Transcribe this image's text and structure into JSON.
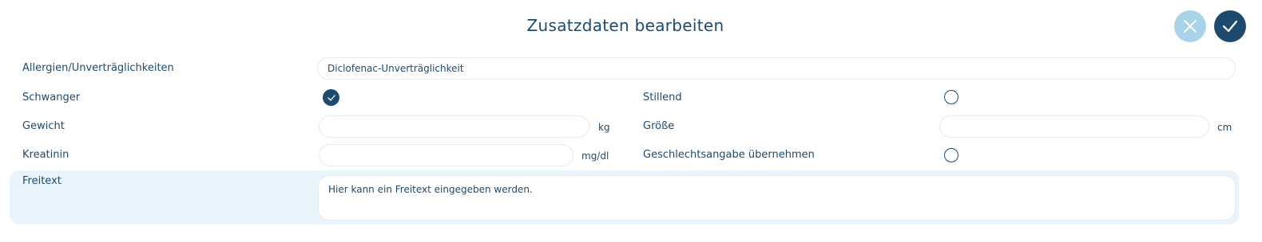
{
  "dialog": {
    "title": "Zusatzdaten bearbeiten"
  },
  "actions": {
    "cancel_icon": "close-icon",
    "confirm_icon": "check-icon"
  },
  "allergies": {
    "label": "Allergien/Unverträglichkeiten",
    "value": "Diclofenac-Unverträglichkeit"
  },
  "pregnant": {
    "label": "Schwanger",
    "checked": true
  },
  "breastfeeding": {
    "label": "Stillend",
    "checked": false
  },
  "weight": {
    "label": "Gewicht",
    "value": "",
    "unit": "kg"
  },
  "height": {
    "label": "Größe",
    "value": "",
    "unit": "cm"
  },
  "creatinine": {
    "label": "Kreatinin",
    "value": "",
    "unit": "mg/dl"
  },
  "gender": {
    "label": "Geschlechtsangabe übernehmen",
    "checked": false
  },
  "freitext": {
    "label": "Freitext",
    "value": "",
    "placeholder": "Hier kann ein Freitext eingegeben werden."
  },
  "colors": {
    "primary": "#1e4a6d",
    "cancel": "#a8d3e8",
    "panel": "#eaf4fb"
  }
}
